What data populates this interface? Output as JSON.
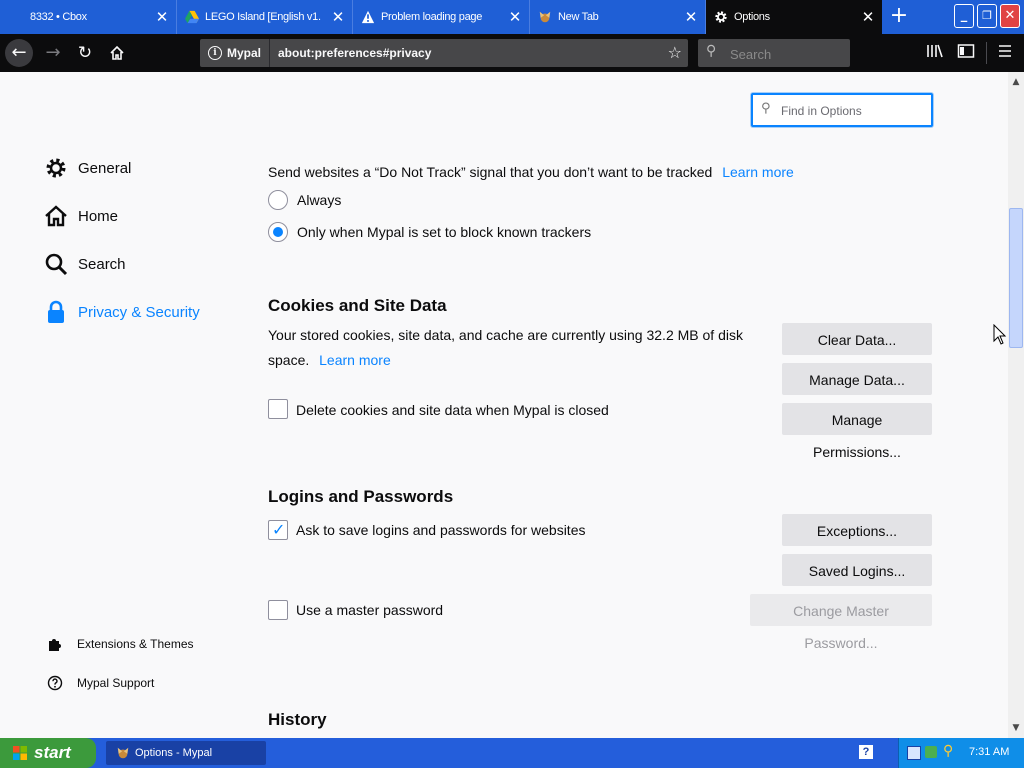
{
  "tabs": [
    {
      "title": "8332 • Cbox",
      "icon": "none"
    },
    {
      "title": "LEGO Island [English v1.",
      "icon": "drive-icon"
    },
    {
      "title": "Problem loading page",
      "icon": "warning-icon"
    },
    {
      "title": "New Tab",
      "icon": "mypal-icon"
    },
    {
      "title": "Options",
      "icon": "gear-icon"
    }
  ],
  "window_controls": {
    "minimize": "_",
    "restore": "❐",
    "close": "✕"
  },
  "navbar": {
    "identity_label": "Mypal",
    "url": "about:preferences#privacy",
    "search_placeholder": "Search"
  },
  "find": {
    "placeholder": "Find in Options"
  },
  "sidebar": {
    "items": [
      {
        "label": "General",
        "icon": "gear-icon"
      },
      {
        "label": "Home",
        "icon": "home-icon"
      },
      {
        "label": "Search",
        "icon": "search-icon"
      },
      {
        "label": "Privacy & Security",
        "icon": "lock-icon",
        "active": true
      }
    ],
    "footer": [
      {
        "label": "Extensions & Themes",
        "icon": "puzzle-icon"
      },
      {
        "label": "Mypal Support",
        "icon": "help-icon"
      }
    ]
  },
  "dnt": {
    "text": "Send websites a “Do Not Track” signal that you don’t want to be tracked",
    "learn_more": "Learn more",
    "options": [
      {
        "label": "Always",
        "checked": false
      },
      {
        "label": "Only when Mypal is set to block known trackers",
        "checked": true
      }
    ]
  },
  "cookies": {
    "heading": "Cookies and Site Data",
    "desc_line1": "Your stored cookies, site data, and cache are currently using 32.2 MB of disk",
    "desc_line2": "space.",
    "learn_more": "Learn more",
    "delete_label": "Delete cookies and site data when Mypal is closed",
    "delete_checked": false,
    "buttons": {
      "clear": "Clear Data...",
      "manage": "Manage Data...",
      "permissions": "Manage Permissions..."
    }
  },
  "logins": {
    "heading": "Logins and Passwords",
    "ask_label": "Ask to save logins and passwords for websites",
    "ask_checked": true,
    "master_label": "Use a master password",
    "master_checked": false,
    "buttons": {
      "exceptions": "Exceptions...",
      "saved": "Saved Logins...",
      "change_master": "Change Master Password..."
    }
  },
  "history": {
    "heading": "History"
  },
  "taskbar": {
    "start": "start",
    "task": "Options - Mypal",
    "clock": "7:31 AM"
  },
  "colors": {
    "accent": "#0a84ff",
    "titlebar": "#1f5fd6",
    "taskbar": "#245edb"
  }
}
